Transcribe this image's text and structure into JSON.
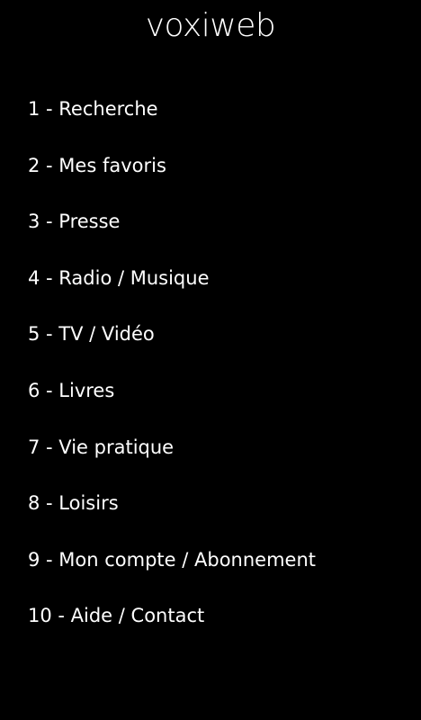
{
  "app": {
    "logo_text": "voxiweb"
  },
  "menu": {
    "items": [
      {
        "label": "1 - Recherche"
      },
      {
        "label": "2 - Mes favoris"
      },
      {
        "label": "3 - Presse"
      },
      {
        "label": "4 - Radio / Musique"
      },
      {
        "label": "5 - TV / Vidéo"
      },
      {
        "label": "6 - Livres"
      },
      {
        "label": "7 - Vie pratique"
      },
      {
        "label": "8 - Loisirs"
      },
      {
        "label": "9 - Mon compte / Abonnement"
      },
      {
        "label": "10 - Aide / Contact"
      }
    ]
  },
  "colors": {
    "background": "#000000",
    "text": "#ffffff"
  }
}
